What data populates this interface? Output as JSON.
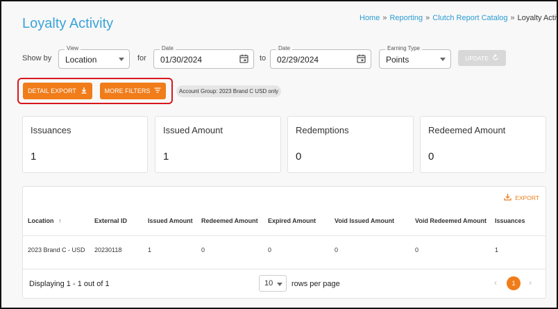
{
  "page": {
    "title": "Loyalty Activity",
    "breadcrumb": [
      "Home",
      "Reporting",
      "Clutch Report Catalog",
      "Loyalty Activit"
    ],
    "breadcrumb_separator": "»"
  },
  "filters": {
    "show_by_label": "Show by",
    "view": {
      "label": "View",
      "value": "Location"
    },
    "for_label": "for",
    "date_from": {
      "label": "Date",
      "value": "01/30/2024"
    },
    "to_label": "to",
    "date_to": {
      "label": "Date",
      "value": "02/29/2024"
    },
    "earning_type": {
      "label": "Earning Type",
      "value": "Points"
    },
    "update_label": "UPDATE"
  },
  "actions": {
    "detail_export_label": "DETAIL EXPORT",
    "more_filters_label": "MORE FILTERS",
    "account_group_chip": "Account Group: 2023 Brand C USD only"
  },
  "stats": [
    {
      "label": "Issuances",
      "value": "1"
    },
    {
      "label": "Issued Amount",
      "value": "1"
    },
    {
      "label": "Redemptions",
      "value": "0"
    },
    {
      "label": "Redeemed Amount",
      "value": "0"
    }
  ],
  "table": {
    "export_label": "EXPORT",
    "columns": [
      "Location",
      "External ID",
      "Issued Amount",
      "Redeemed Amount",
      "Expired Amount",
      "Void Issued Amount",
      "Void Redeemed Amount",
      "Issuances"
    ],
    "rows": [
      [
        "2023 Brand C - USD",
        "20230118",
        "1",
        "0",
        "0",
        "0",
        "0",
        "1"
      ]
    ],
    "footer": {
      "displaying": "Displaying 1 - 1 out of 1",
      "rows_per_page_value": "10",
      "rows_per_page_label": "rows per page",
      "current_page": "1",
      "prev": "‹",
      "next": "›"
    }
  },
  "colors": {
    "accent": "#f07c1a",
    "title": "#3aa3d9",
    "link": "#2b9bd3",
    "highlight": "#d9161d"
  },
  "icons": [
    "calendar-icon",
    "chevron-down-icon",
    "refresh-icon",
    "download-icon",
    "filter-icon",
    "sort-arrow-up-icon"
  ]
}
